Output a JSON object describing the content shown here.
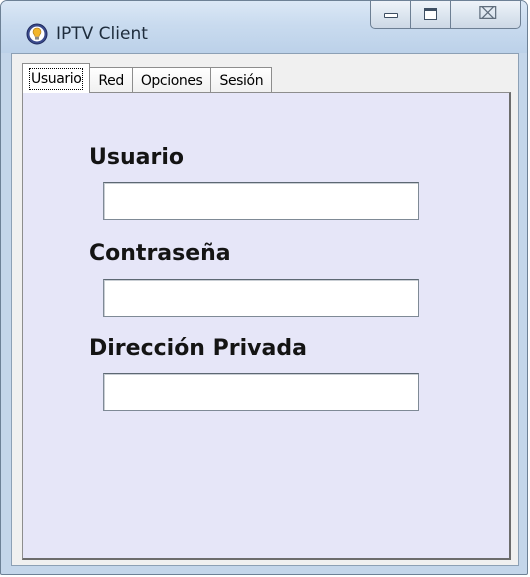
{
  "window": {
    "title": "IPTV Client",
    "controls": {
      "minimize_icon": "minimize-icon",
      "maximize_icon": "maximize-icon",
      "close_glyph": "⌧"
    }
  },
  "tabs": [
    {
      "label": "Usuario",
      "active": true
    },
    {
      "label": "Red",
      "active": false
    },
    {
      "label": "Opciones",
      "active": false
    },
    {
      "label": "Sesión",
      "active": false
    }
  ],
  "form": {
    "usuario": {
      "label": "Usuario",
      "value": ""
    },
    "contrasena": {
      "label": "Contraseña",
      "value": ""
    },
    "direccion": {
      "label": "Dirección Privada",
      "value": ""
    }
  },
  "colors": {
    "panel_background": "#e6e6f8",
    "titlebar": "#c9dbef",
    "label_text": "#141414"
  }
}
